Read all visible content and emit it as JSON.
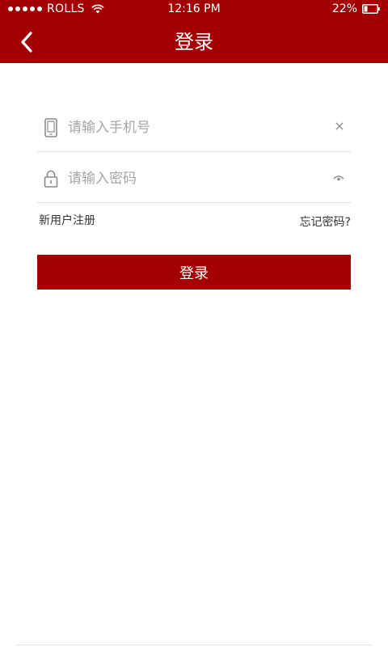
{
  "status_bar": {
    "carrier": "ROLLS",
    "time": "12:16 PM",
    "battery": "22%"
  },
  "header": {
    "title": "登录",
    "back_icon": "chevron-left-icon"
  },
  "form": {
    "phone": {
      "placeholder": "请输入手机号",
      "value": "",
      "icon": "phone-icon",
      "clear_icon": "close-icon"
    },
    "password": {
      "placeholder": "请输入密码",
      "value": "",
      "icon": "lock-icon",
      "toggle_icon": "eye-icon"
    }
  },
  "links": {
    "register": "新用户注册",
    "forgot": "忘记密码?"
  },
  "login_button": "登录",
  "colors": {
    "brand": "#a30004",
    "placeholder": "#a6a6a6",
    "divider": "#e0e0e0"
  }
}
